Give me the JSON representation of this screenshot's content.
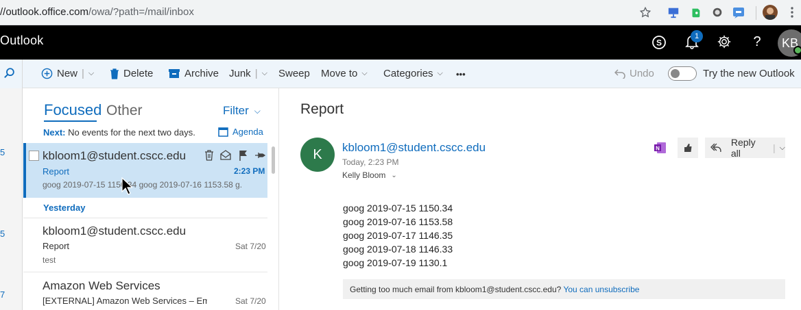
{
  "browser": {
    "url_host": "//outlook.office.com",
    "url_path": "/owa/?path=/mail/inbox"
  },
  "topbar": {
    "brand": "Outlook",
    "notification_count": "1",
    "avatar_initials": "KB"
  },
  "commands": {
    "new": "New",
    "delete": "Delete",
    "archive": "Archive",
    "junk": "Junk",
    "sweep": "Sweep",
    "move_to": "Move to",
    "categories": "Categories",
    "more": "•••",
    "undo": "Undo",
    "try_new": "Try the new Outlook"
  },
  "rail": {
    "nums": [
      "5",
      "5",
      "7"
    ]
  },
  "list": {
    "tab_focused": "Focused",
    "tab_other": "Other",
    "filter": "Filter",
    "next_label": "Next:",
    "next_text": "No events for the next two days.",
    "agenda": "Agenda",
    "group_yesterday": "Yesterday",
    "items": [
      {
        "sender": "kbloom1@student.cscc.edu",
        "subject": "Report",
        "preview": "goog 2019-07-15 1150.34 goog 2019-07-16 1153.58 g...",
        "time": "2:23 PM"
      },
      {
        "sender": "kbloom1@student.cscc.edu",
        "subject": "Report",
        "preview": "test",
        "time": "Sat 7/20"
      },
      {
        "sender": "Amazon Web Services",
        "subject": "[EXTERNAL] Amazon Web Services – Email Ac",
        "preview": "",
        "time": "Sat 7/20"
      }
    ]
  },
  "message": {
    "title": "Report",
    "avatar_initial": "K",
    "from": "kbloom1@student.cscc.edu",
    "date": "Today, 2:23 PM",
    "to": "Kelly Bloom",
    "reply_all": "Reply all",
    "body": [
      "goog 2019-07-15 1150.34",
      "goog 2019-07-16 1153.58",
      "goog 2019-07-17 1146.35",
      "goog 2019-07-18 1146.33",
      "goog 2019-07-19 1130.1"
    ],
    "unsub_text": "Getting too much email from kbloom1@student.cscc.edu?",
    "unsub_link": "You can unsubscribe"
  },
  "colors": {
    "accent": "#0f6cbd",
    "selected_bg": "#cce3f5",
    "avatar_green": "#2d7a4b"
  }
}
